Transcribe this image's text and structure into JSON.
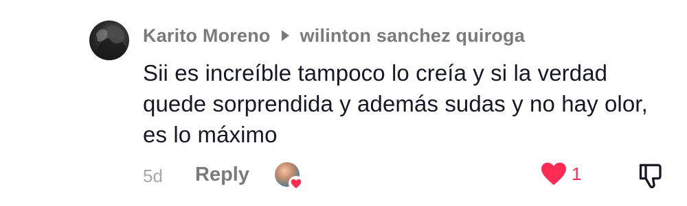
{
  "comment": {
    "author": "Karito Moreno",
    "reply_to": "wilinton sanchez quiroga",
    "text": "Sii es increíble tampoco lo creía y si la verdad quede sorprendida y además sudas y no hay olor, es lo máximo",
    "time": "5d",
    "reply_label": "Reply",
    "likes": "1",
    "creator_liked": true
  },
  "icons": {
    "avatar": "user-avatar",
    "reply_caret": "caret-right-icon",
    "creator_liked_badge": "heart-badge-icon",
    "like": "heart-icon",
    "dislike": "thumbs-down-icon"
  },
  "colors": {
    "text": "#161823",
    "meta": "#7a7a7a",
    "time": "#a8a8a8",
    "like": "#fe2c55"
  }
}
